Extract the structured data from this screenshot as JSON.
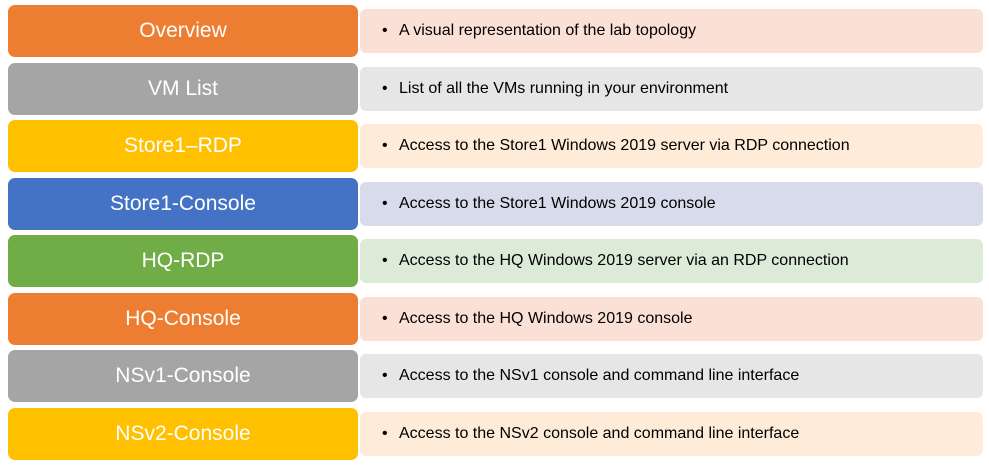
{
  "rows": [
    {
      "label": "Overview",
      "desc": "A visual representation of the lab topology",
      "color": "#ED7D31",
      "light": "#FBE0D6"
    },
    {
      "label": "VM List",
      "desc": "List of all the VMs running in your environment",
      "color": "#A5A5A5",
      "light": "#E6E6E6"
    },
    {
      "label": "Store1–RDP",
      "desc": "Access to the Store1 Windows 2019 server via RDP connection",
      "color": "#FFC000",
      "light": "#FEEBD8"
    },
    {
      "label": "Store1-Console",
      "desc": "Access to the Store1 Windows 2019 console",
      "color": "#4472C4",
      "light": "#D7DBEC"
    },
    {
      "label": "HQ-RDP",
      "desc": "Access to the HQ Windows 2019 server via an RDP connection",
      "color": "#70AD47",
      "light": "#DCEBD7"
    },
    {
      "label": "HQ-Console",
      "desc": "Access to the HQ Windows 2019 console",
      "color": "#ED7D31",
      "light": "#FBE0D6"
    },
    {
      "label": "NSv1-Console",
      "desc": "Access to the NSv1 console and command  line interface",
      "color": "#A5A5A5",
      "light": "#E6E6E6"
    },
    {
      "label": "NSv2-Console",
      "desc": "Access to the NSv2 console and command  line interface",
      "color": "#FFC000",
      "light": "#FEEBD8"
    }
  ],
  "bullet": "•"
}
